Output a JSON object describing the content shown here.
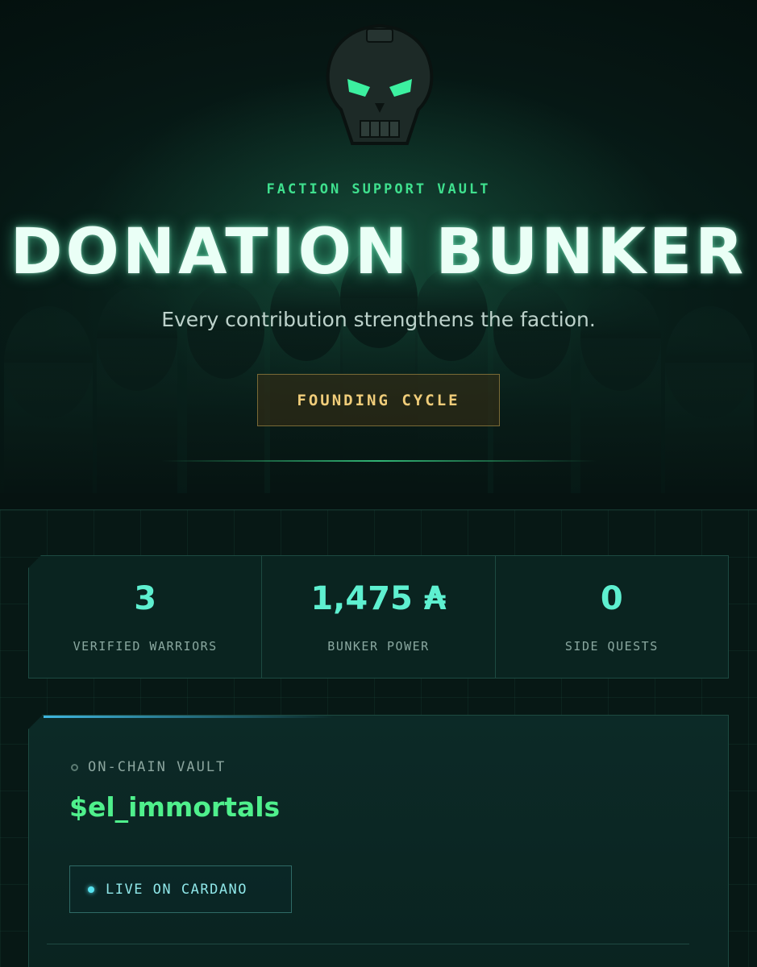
{
  "hero": {
    "emblem_icon": "skull-icon",
    "eyebrow": "FACTION SUPPORT VAULT",
    "title": "DONATION BUNKER",
    "subtitle": "Every contribution strengthens the faction.",
    "cycle_button": "FOUNDING CYCLE"
  },
  "stats": [
    {
      "value": "3",
      "label": "VERIFIED WARRIORS"
    },
    {
      "value": "1,475 ₳",
      "label": "BUNKER POWER"
    },
    {
      "value": "0",
      "label": "SIDE QUESTS"
    }
  ],
  "vault": {
    "tag": "ON-CHAIN VAULT",
    "handle": "$el_immortals",
    "badge": "LIVE ON CARDANO"
  },
  "colors": {
    "accent_green": "#4ff08c",
    "stat_teal": "#5ef0d0",
    "gold": "#f0cd7a",
    "background": "#061311"
  }
}
